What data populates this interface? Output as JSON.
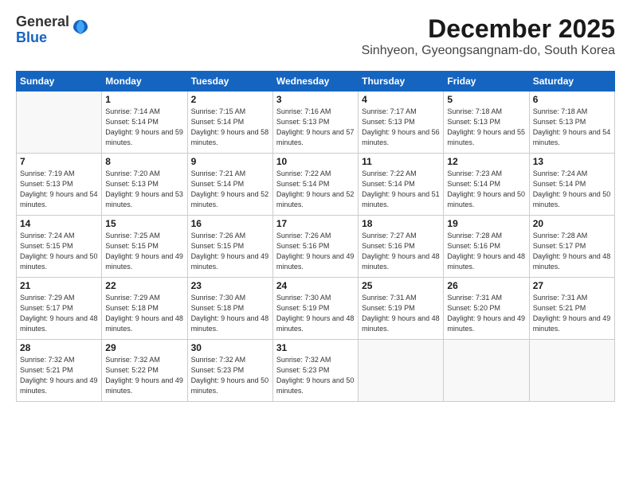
{
  "logo": {
    "line1": "General",
    "line2": "Blue"
  },
  "title": "December 2025",
  "location": "Sinhyeon, Gyeongsangnam-do, South Korea",
  "weekdays": [
    "Sunday",
    "Monday",
    "Tuesday",
    "Wednesday",
    "Thursday",
    "Friday",
    "Saturday"
  ],
  "weeks": [
    [
      {
        "day": "",
        "empty": true
      },
      {
        "day": "1",
        "sunrise": "7:14 AM",
        "sunset": "5:14 PM",
        "daylight": "9 hours and 59 minutes."
      },
      {
        "day": "2",
        "sunrise": "7:15 AM",
        "sunset": "5:14 PM",
        "daylight": "9 hours and 58 minutes."
      },
      {
        "day": "3",
        "sunrise": "7:16 AM",
        "sunset": "5:13 PM",
        "daylight": "9 hours and 57 minutes."
      },
      {
        "day": "4",
        "sunrise": "7:17 AM",
        "sunset": "5:13 PM",
        "daylight": "9 hours and 56 minutes."
      },
      {
        "day": "5",
        "sunrise": "7:18 AM",
        "sunset": "5:13 PM",
        "daylight": "9 hours and 55 minutes."
      },
      {
        "day": "6",
        "sunrise": "7:18 AM",
        "sunset": "5:13 PM",
        "daylight": "9 hours and 54 minutes."
      }
    ],
    [
      {
        "day": "7",
        "sunrise": "7:19 AM",
        "sunset": "5:13 PM",
        "daylight": "9 hours and 54 minutes."
      },
      {
        "day": "8",
        "sunrise": "7:20 AM",
        "sunset": "5:13 PM",
        "daylight": "9 hours and 53 minutes."
      },
      {
        "day": "9",
        "sunrise": "7:21 AM",
        "sunset": "5:14 PM",
        "daylight": "9 hours and 52 minutes."
      },
      {
        "day": "10",
        "sunrise": "7:22 AM",
        "sunset": "5:14 PM",
        "daylight": "9 hours and 52 minutes."
      },
      {
        "day": "11",
        "sunrise": "7:22 AM",
        "sunset": "5:14 PM",
        "daylight": "9 hours and 51 minutes."
      },
      {
        "day": "12",
        "sunrise": "7:23 AM",
        "sunset": "5:14 PM",
        "daylight": "9 hours and 50 minutes."
      },
      {
        "day": "13",
        "sunrise": "7:24 AM",
        "sunset": "5:14 PM",
        "daylight": "9 hours and 50 minutes."
      }
    ],
    [
      {
        "day": "14",
        "sunrise": "7:24 AM",
        "sunset": "5:15 PM",
        "daylight": "9 hours and 50 minutes."
      },
      {
        "day": "15",
        "sunrise": "7:25 AM",
        "sunset": "5:15 PM",
        "daylight": "9 hours and 49 minutes."
      },
      {
        "day": "16",
        "sunrise": "7:26 AM",
        "sunset": "5:15 PM",
        "daylight": "9 hours and 49 minutes."
      },
      {
        "day": "17",
        "sunrise": "7:26 AM",
        "sunset": "5:16 PM",
        "daylight": "9 hours and 49 minutes."
      },
      {
        "day": "18",
        "sunrise": "7:27 AM",
        "sunset": "5:16 PM",
        "daylight": "9 hours and 48 minutes."
      },
      {
        "day": "19",
        "sunrise": "7:28 AM",
        "sunset": "5:16 PM",
        "daylight": "9 hours and 48 minutes."
      },
      {
        "day": "20",
        "sunrise": "7:28 AM",
        "sunset": "5:17 PM",
        "daylight": "9 hours and 48 minutes."
      }
    ],
    [
      {
        "day": "21",
        "sunrise": "7:29 AM",
        "sunset": "5:17 PM",
        "daylight": "9 hours and 48 minutes."
      },
      {
        "day": "22",
        "sunrise": "7:29 AM",
        "sunset": "5:18 PM",
        "daylight": "9 hours and 48 minutes."
      },
      {
        "day": "23",
        "sunrise": "7:30 AM",
        "sunset": "5:18 PM",
        "daylight": "9 hours and 48 minutes."
      },
      {
        "day": "24",
        "sunrise": "7:30 AM",
        "sunset": "5:19 PM",
        "daylight": "9 hours and 48 minutes."
      },
      {
        "day": "25",
        "sunrise": "7:31 AM",
        "sunset": "5:19 PM",
        "daylight": "9 hours and 48 minutes."
      },
      {
        "day": "26",
        "sunrise": "7:31 AM",
        "sunset": "5:20 PM",
        "daylight": "9 hours and 49 minutes."
      },
      {
        "day": "27",
        "sunrise": "7:31 AM",
        "sunset": "5:21 PM",
        "daylight": "9 hours and 49 minutes."
      }
    ],
    [
      {
        "day": "28",
        "sunrise": "7:32 AM",
        "sunset": "5:21 PM",
        "daylight": "9 hours and 49 minutes."
      },
      {
        "day": "29",
        "sunrise": "7:32 AM",
        "sunset": "5:22 PM",
        "daylight": "9 hours and 49 minutes."
      },
      {
        "day": "30",
        "sunrise": "7:32 AM",
        "sunset": "5:23 PM",
        "daylight": "9 hours and 50 minutes."
      },
      {
        "day": "31",
        "sunrise": "7:32 AM",
        "sunset": "5:23 PM",
        "daylight": "9 hours and 50 minutes."
      },
      {
        "day": "",
        "empty": true
      },
      {
        "day": "",
        "empty": true
      },
      {
        "day": "",
        "empty": true
      }
    ]
  ]
}
